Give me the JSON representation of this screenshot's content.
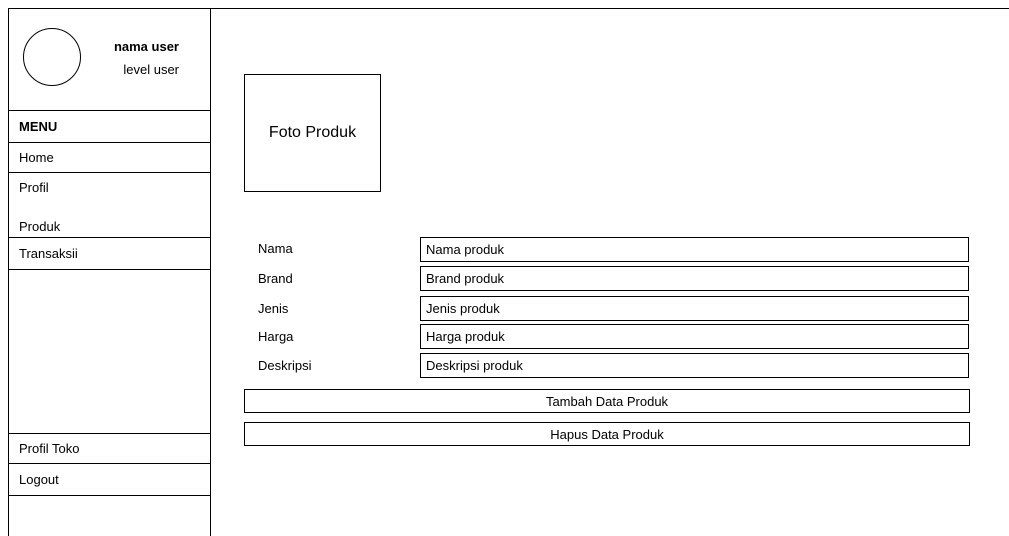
{
  "user": {
    "name": "nama user",
    "level": "level user"
  },
  "sidebar": {
    "menu_header": "MENU",
    "items": [
      "Home",
      "Profil",
      "Produk",
      "Transaksii"
    ],
    "bottom_items": [
      "Profil Toko",
      "Logout"
    ]
  },
  "product": {
    "photo_label": "Foto Produk",
    "fields": [
      {
        "label": "Nama",
        "value": "Nama produk"
      },
      {
        "label": "Brand",
        "value": "Brand produk"
      },
      {
        "label": "Jenis",
        "value": "Jenis produk"
      },
      {
        "label": "Harga",
        "value": "Harga produk"
      },
      {
        "label": "Deskripsi",
        "value": "Deskripsi produk"
      }
    ],
    "add_button": "Tambah Data Produk",
    "delete_button": "Hapus Data Produk"
  }
}
